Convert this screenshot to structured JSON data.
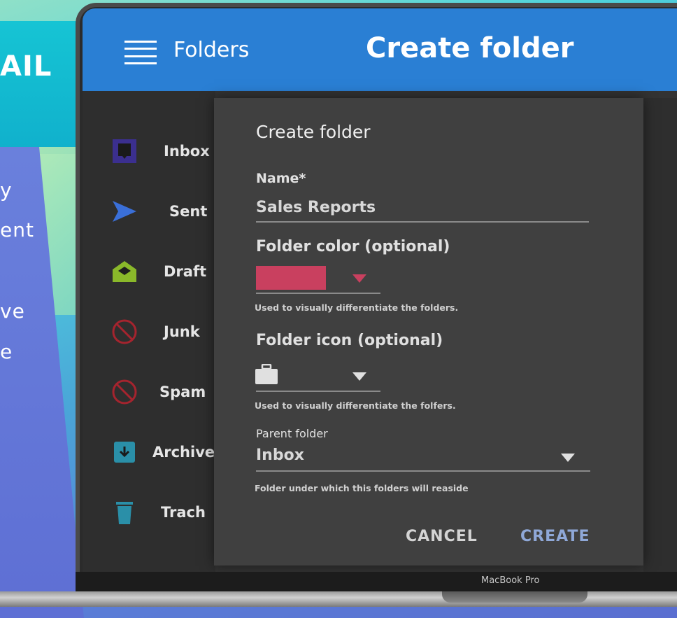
{
  "promo": {
    "line1": "AIL",
    "line2": "y",
    "line3": "ent",
    "line4": "ve",
    "line5": "e"
  },
  "topbar": {
    "menu_icon": "hamburger-icon",
    "folders_label": "Folders",
    "title": "Create folder"
  },
  "sidebar": {
    "items": [
      {
        "label": "Inbox",
        "icon": "inbox-icon"
      },
      {
        "label": "Sent",
        "icon": "send-icon"
      },
      {
        "label": "Draft",
        "icon": "draft-icon"
      },
      {
        "label": "Junk",
        "icon": "block-icon"
      },
      {
        "label": "Spam",
        "icon": "block-icon"
      },
      {
        "label": "Archive",
        "icon": "archive-icon"
      },
      {
        "label": "Trach",
        "icon": "trash-icon"
      }
    ]
  },
  "dialog": {
    "title": "Create folder",
    "name_label": "Name*",
    "name_value": "Sales Reports",
    "color_label": "Folder color (optional)",
    "color_value": "#c9405f",
    "color_help": "Used to visually differentiate the folders.",
    "icon_label": "Folder icon (optional)",
    "icon_value": "briefcase-icon",
    "icon_help": "Used to visually differentiate the folfers.",
    "parent_label": "Parent folder",
    "parent_value": "Inbox",
    "parent_help": "Folder under which this folders will reaside",
    "cancel_label": "CANCEL",
    "create_label": "CREATE"
  },
  "device": {
    "model": "MacBook Pro"
  },
  "colors": {
    "accent": "#2a7fd4",
    "create_button": "#8fa8d8",
    "swatch": "#c9405f"
  }
}
